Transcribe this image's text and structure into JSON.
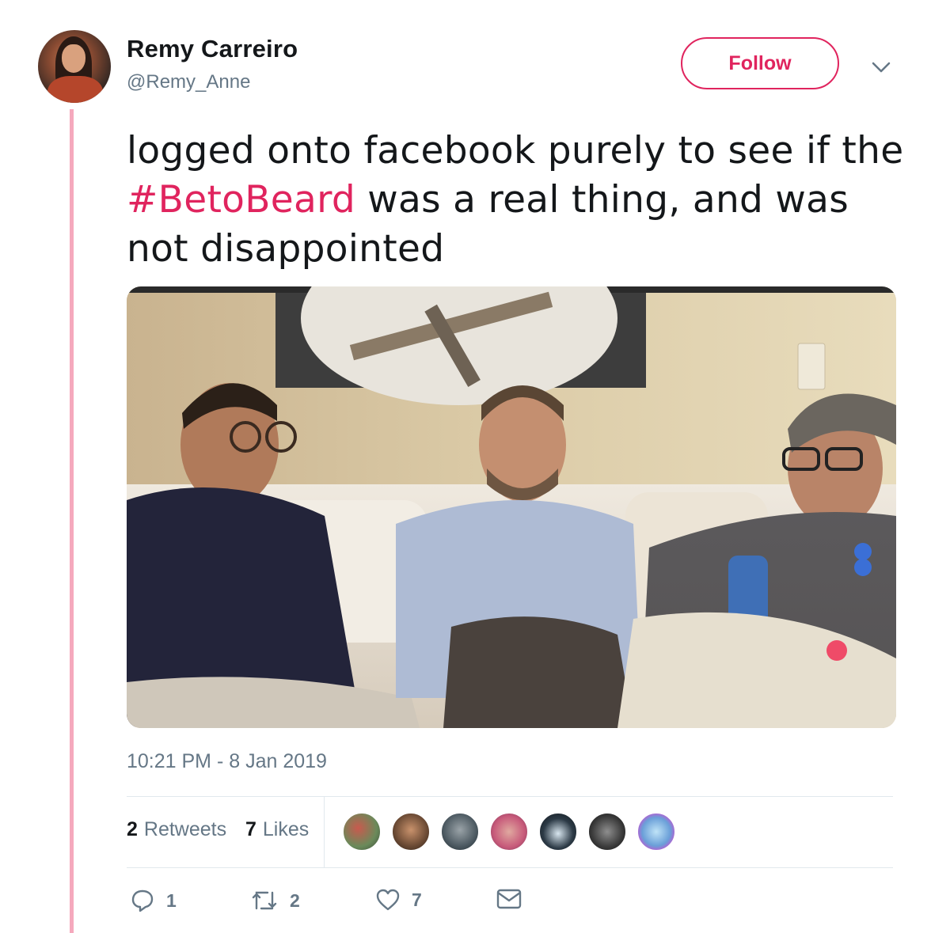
{
  "user": {
    "name": "Remy Carreiro",
    "handle": "@Remy_Anne"
  },
  "follow_label": "Follow",
  "tweet": {
    "text_before": "logged onto facebook purely to see if the ",
    "hashtag": "#BetoBeard",
    "text_after": " was a real thing, and was not disappointed"
  },
  "timestamp": "10:21 PM - 8 Jan 2019",
  "stats": {
    "retweets_count": "2",
    "retweets_label": "Retweets",
    "likes_count": "7",
    "likes_label": "Likes"
  },
  "actions": {
    "reply_count": "1",
    "retweet_count": "2",
    "like_count": "7"
  },
  "icons": [
    "chevron-down-icon",
    "reply-icon",
    "retweet-icon",
    "heart-icon",
    "mail-icon"
  ],
  "colors": {
    "accent": "#e0245e",
    "thread_line": "#f5a9bd",
    "secondary_text": "#657786",
    "divider": "#e1e8ed"
  }
}
